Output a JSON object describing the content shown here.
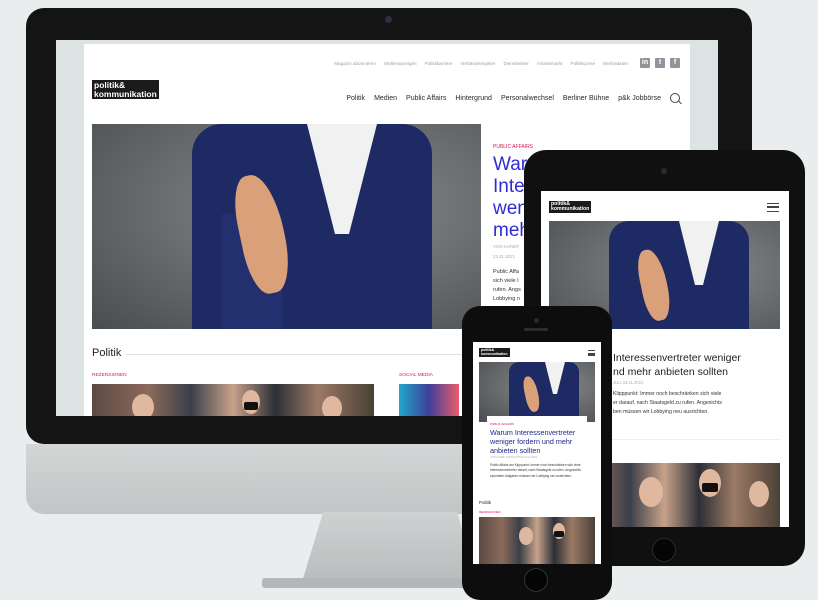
{
  "site": {
    "logo": {
      "line1": "politik&",
      "line2": "kommunikation"
    },
    "top_nav": [
      "Magazin abonnieren",
      "Stellenanzeigen",
      "Politikkarriere",
      "Verbänderegister",
      "Dienstleister",
      "Arbeitsmarkt",
      "Politikszene",
      "Werbedaten"
    ],
    "social": [
      {
        "icon": "linkedin-icon",
        "glyph": "in"
      },
      {
        "icon": "twitter-icon",
        "glyph": "t"
      },
      {
        "icon": "facebook-icon",
        "glyph": "f"
      }
    ],
    "main_nav": [
      "Politik",
      "Medien",
      "Public Affairs",
      "Hintergrund",
      "Personalwechsel",
      "Berliner Bühne",
      "p&k Jobbörse"
    ]
  },
  "desktop": {
    "feature": {
      "tag": "PUBLIC AFFAIRS",
      "headline_fragments": [
        "War",
        "Inter",
        "wen",
        "meh"
      ],
      "meta_author": "VON HANEF",
      "meta_date": "23.11.2021",
      "body_fragments": [
        "Public Affa",
        "sich viele I",
        "rufen. Angs",
        "Lobbying n"
      ]
    },
    "section_title": "Politik",
    "categories": [
      "REZENSIONEN",
      "SOCIAL MEDIA"
    ]
  },
  "tablet": {
    "headline_lines": [
      "Interessenvertreter weniger",
      "nd mehr anbieten sollten"
    ],
    "meta": "JULI    23.11.2021",
    "body_lines": [
      "Klipppunkt: Immer noch beschränken sich viele",
      "er darauf, nach Staatsgeld zu rufen. Angesichts",
      "ben müssen wir Lobbying neu ausrichten."
    ]
  },
  "phone": {
    "tag": "PUBLIC AFFAIRS",
    "headline": "Warum Interessenvertreter weniger fordern und mehr anbieten sollten",
    "meta": "VON HANEF & BÜLAUSTAN    23.11.2021",
    "body": "Public Affairs am Kipppunkt: Immer noch beschränken sich viele Interessenvertreter darauf, nach Staatsgeld zu rufen. Angesichts epochaler Aufgaben müssen wir Lobbying neu ausrichten.",
    "section_title": "Politik",
    "category": "REZENSIONEN"
  },
  "colors": {
    "accent_pink": "#d8145c",
    "headline_blue": "#2f2bd6",
    "suit_navy": "#1d2a63"
  }
}
